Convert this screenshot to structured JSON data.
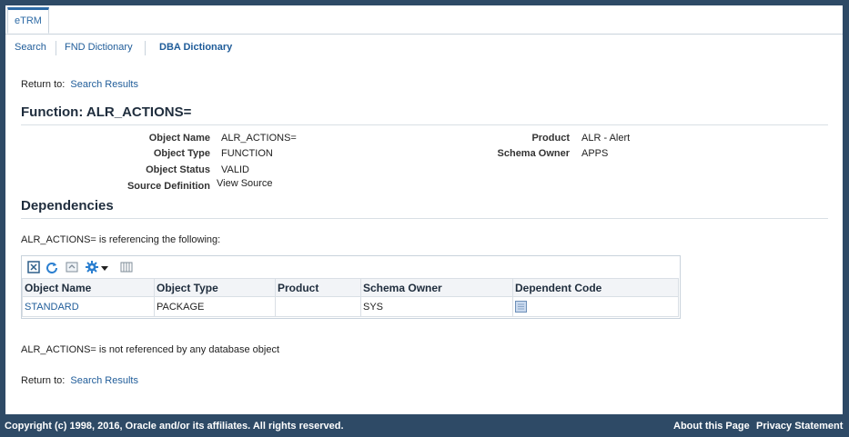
{
  "tab": {
    "label": "eTRM"
  },
  "subnav": {
    "search": "Search",
    "fnd": "FND Dictionary",
    "dba": "DBA Dictionary"
  },
  "return_to": {
    "label": "Return to:",
    "link": "Search Results"
  },
  "page_title": "Function: ALR_ACTIONS=",
  "details": {
    "object_name_label": "Object Name",
    "object_name": "ALR_ACTIONS=",
    "object_type_label": "Object Type",
    "object_type": "FUNCTION",
    "object_status_label": "Object Status",
    "object_status": "VALID",
    "source_definition_label": "Source Definition",
    "source_definition_link": "View Source",
    "product_label": "Product",
    "product": "ALR - Alert",
    "schema_owner_label": "Schema Owner",
    "schema_owner": "APPS"
  },
  "dependencies": {
    "title": "Dependencies",
    "referencing_text": "ALR_ACTIONS= is referencing the following:",
    "table": {
      "headers": [
        "Object Name",
        "Object Type",
        "Product",
        "Schema Owner",
        "Dependent Code"
      ],
      "rows": [
        {
          "object_name": "STANDARD",
          "object_type": "PACKAGE",
          "product": "",
          "schema_owner": "SYS",
          "dependent_code_icon": "document-icon"
        }
      ]
    },
    "not_referenced_text": "ALR_ACTIONS= is not referenced by any database object"
  },
  "toolbar_icons": [
    "detach-icon",
    "refresh-icon",
    "export-icon",
    "gear-icon",
    "chevron-down-icon",
    "freeze-column-icon"
  ],
  "footer": {
    "copyright": "Copyright (c) 1998, 2016, Oracle and/or its affiliates. All rights reserved.",
    "about": "About this Page",
    "privacy": "Privacy Statement"
  },
  "colors": {
    "link": "#1f5c99",
    "frame": "#2e4a66",
    "header_bg": "#f2f4f7"
  }
}
